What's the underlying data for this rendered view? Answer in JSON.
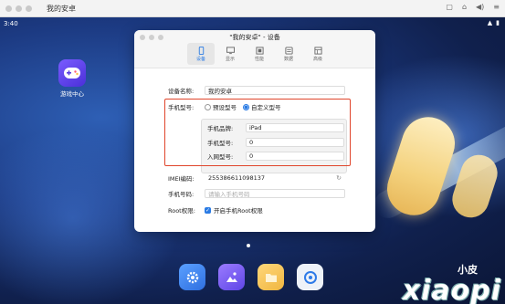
{
  "host": {
    "title": "我的安卓"
  },
  "status": {
    "time": "3:40"
  },
  "desktop": {
    "app_label": "游戏中心"
  },
  "dialog": {
    "title": "\"我的安卓\" - 设备",
    "tabs": [
      {
        "label": "设备",
        "icon": "phone-icon"
      },
      {
        "label": "显示",
        "icon": "display-icon"
      },
      {
        "label": "性能",
        "icon": "performance-icon"
      },
      {
        "label": "数据",
        "icon": "data-icon"
      },
      {
        "label": "高级",
        "icon": "advanced-icon"
      }
    ],
    "device_name": {
      "label": "设备名称:",
      "value": "我的安卓"
    },
    "phone_model": {
      "label": "手机型号:",
      "option_default": "预设型号",
      "option_custom": "自定义型号"
    },
    "brand": {
      "label": "手机品牌:",
      "value": "iPad"
    },
    "model": {
      "label": "手机型号:",
      "value": "0"
    },
    "network": {
      "label": "入网型号:",
      "value": "0"
    },
    "imei": {
      "label": "IMEI编码:",
      "value": "255386611098137"
    },
    "phone_number": {
      "label": "手机号码:",
      "placeholder": "请输入手机号码"
    },
    "root": {
      "label": "Root权限:",
      "option": "开启手机Root权限"
    }
  },
  "watermark": {
    "small": "小皮",
    "big": "xiaopi"
  },
  "colors": {
    "accent": "#2a7be4",
    "highlight": "#e0452b"
  }
}
